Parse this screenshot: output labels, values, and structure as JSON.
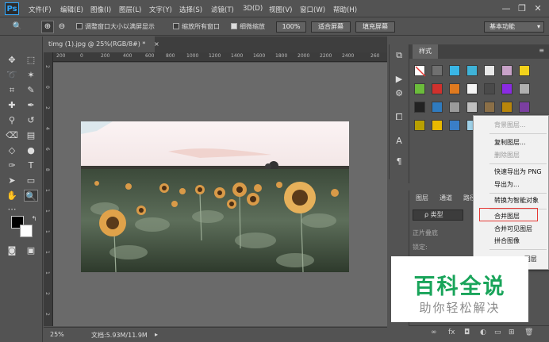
{
  "app": {
    "logo": "Ps"
  },
  "menubar": {
    "items": [
      "文件(F)",
      "编辑(E)",
      "图像(I)",
      "图层(L)",
      "文字(Y)",
      "选择(S)",
      "滤镜(T)",
      "3D(D)",
      "视图(V)",
      "窗口(W)",
      "帮助(H)"
    ],
    "minimize": "—",
    "maximize": "❐",
    "close": "✕"
  },
  "options": {
    "resize_window": "调整窗口大小以满屏显示",
    "zoom_all_windows": "缩放所有窗口",
    "scrubby_zoom": "细微缩放",
    "zoom_percent": "100%",
    "fit_screen": "适合屏幕",
    "fill_screen": "填充屏幕",
    "workspace": "基本功能",
    "scrubby_checked": true
  },
  "document": {
    "tab_title": "timg (1).jpg @ 25%(RGB/8#) *",
    "close_glyph": "×",
    "ruler_h": [
      "200",
      "0",
      "200",
      "400",
      "600",
      "800",
      "1000",
      "1200",
      "1400",
      "1600",
      "1800",
      "2000",
      "2200",
      "2400",
      "260"
    ],
    "ruler_v": [
      "2",
      "0",
      "2",
      "4",
      "6",
      "8",
      "1",
      "1",
      "1",
      "1",
      "1",
      "2",
      "2"
    ]
  },
  "status": {
    "zoom": "25%",
    "doc_size": "文档:5.93M/11.9M"
  },
  "styles_panel": {
    "tab": "样式",
    "swatches": [
      [
        "#ffffff",
        "#707070",
        "#39b6e6",
        "#3fb3d8",
        "#e8e8e8",
        "#c8a2c8",
        "#f2d21b"
      ],
      [
        "#6bbc3b",
        "#d0312d",
        "#e07a1f",
        "#f5f5f5",
        "#4a4a4a",
        "#8a2be2",
        "#b0b0b0"
      ],
      [
        "#222222",
        "#2f7bbf",
        "#9b9b9b",
        "#c0c0c0",
        "#8b6f47",
        "#b8860b",
        "#7b3fa0"
      ],
      [
        "#b8a000",
        "#e8b800",
        "#3a7ec8",
        "#9fd1e8",
        "#d8c080",
        "#e0e0e0",
        "#e53935"
      ]
    ]
  },
  "layers_panel": {
    "tabs": [
      "图层",
      "通道",
      "路径"
    ],
    "filter": "ρ 类型",
    "blend_mode": "正片叠底",
    "lock_label": "锁定:",
    "bottom_icons": [
      "∞",
      "fx",
      "◘",
      "◐",
      "▭",
      "⊞",
      "🗑"
    ]
  },
  "context_menu": {
    "items": [
      {
        "label": "背景图层...",
        "enabled": false
      },
      {
        "label": "复制图层...",
        "enabled": true
      },
      {
        "label": "删除图层",
        "enabled": false
      },
      {
        "label": "快速导出为 PNG",
        "enabled": true
      },
      {
        "label": "导出为...",
        "enabled": true
      },
      {
        "label": "转换为智能对象",
        "enabled": true
      },
      {
        "label": "合并图层",
        "enabled": true
      },
      {
        "label": "合并可见图层",
        "enabled": true
      },
      {
        "label": "拼合图像",
        "enabled": true
      },
      {
        "label": "3D 图层",
        "enabled": true
      }
    ]
  },
  "watermark": {
    "title": "百科全说",
    "subtitle": "助你轻松解决"
  }
}
